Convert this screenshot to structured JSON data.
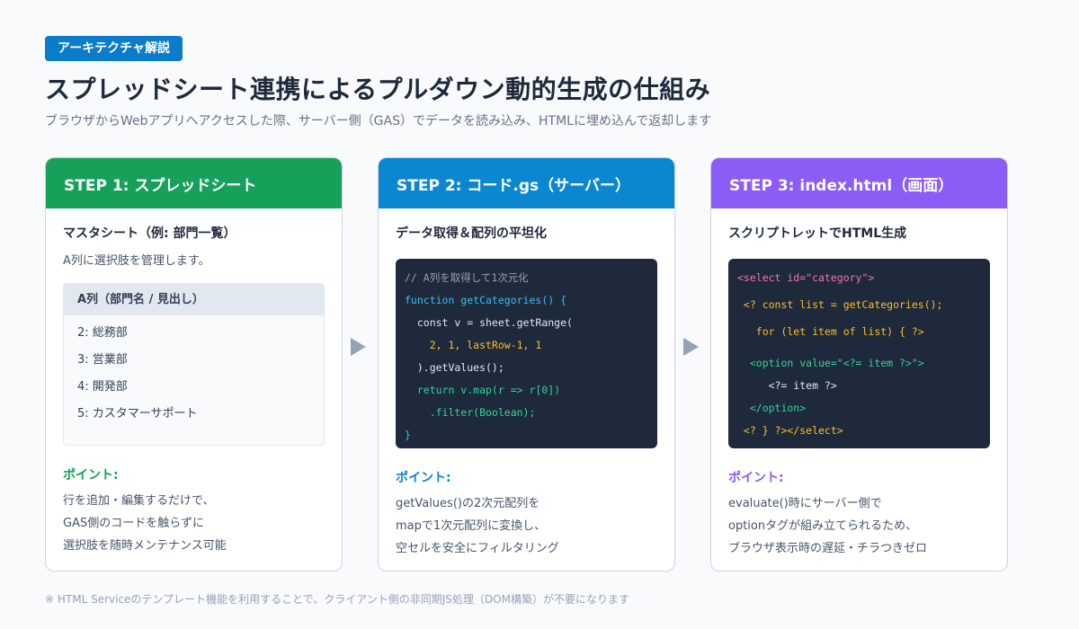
{
  "header": {
    "badge": "アーキテクチャ解説",
    "title": "スプレッドシート連携によるプルダウン動的生成の仕組み",
    "subtitle": "ブラウザからWebアプリへアクセスした際、サーバー側（GAS）でデータを読み込み、HTMLに埋め込んで返却します"
  },
  "colors": {
    "step1": "#16a05a",
    "step2": "#0b87d1",
    "step3": "#8b5cf6",
    "code_comment": "#94a3b8",
    "code_keyword": "#38bdf8",
    "code_text": "#e2e8f0",
    "code_number": "#fbbf24",
    "code_green": "#34d399",
    "code_tag": "#f472b6"
  },
  "step1": {
    "header": "STEP 1: スプレッドシート",
    "section_title": "マスタシート（例: 部門一覧）",
    "section_desc": "A列に選択肢を管理します。",
    "table_header": "A列（部門名 / 見出し）",
    "rows": [
      "2: 総務部",
      "3: 営業部",
      "4: 開発部",
      "5: カスタマーサポート"
    ],
    "point_title": "ポイント:",
    "point_lines": [
      "行を追加・編集するだけで、",
      "GAS側のコードを触らずに",
      "選択肢を随時メンテナンス可能"
    ]
  },
  "step2": {
    "header": "STEP 2: コード.gs（サーバー）",
    "section_title": "データ取得＆配列の平坦化",
    "code": [
      {
        "text": "// A列を取得して1次元化",
        "color": "#94a3b8"
      },
      {
        "text": "function getCategories() {",
        "color": "#38bdf8"
      },
      {
        "text": "  const v = sheet.getRange(",
        "color": "#e2e8f0"
      },
      {
        "text": "    2, 1, lastRow-1, 1",
        "color": "#fbbf24"
      },
      {
        "text": "  ).getValues();",
        "color": "#e2e8f0"
      },
      {
        "text": "  return v.map(r => r[0])",
        "color": "#34d399"
      },
      {
        "text": "    .filter(Boolean);",
        "color": "#34d399"
      },
      {
        "text": "}",
        "color": "#38bdf8"
      }
    ],
    "point_title": "ポイント:",
    "point_lines": [
      "getValues()の2次元配列を",
      "mapで1次元配列に変換し、",
      "空セルを安全にフィルタリング"
    ]
  },
  "step3": {
    "header": "STEP 3: index.html（画面）",
    "section_title": "スクリプトレットでHTML生成",
    "code": [
      {
        "text": "<select id=\"category\">",
        "color": "#f472b6"
      },
      {
        "text": " <? const list = getCategories();",
        "color": "#fbbf24"
      },
      {
        "text": "   for (let item of list) { ?>",
        "color": "#fbbf24"
      },
      {
        "text": "  <option value=\"<?= item ?>\">",
        "color": "#34d399"
      },
      {
        "text": "     <?= item ?>",
        "color": "#e2e8f0"
      },
      {
        "text": "  </option>",
        "color": "#34d399"
      },
      {
        "text": " <? } ?></select>",
        "color": "#fbbf24"
      }
    ],
    "point_title": "ポイント:",
    "point_lines": [
      "evaluate()時にサーバー側で",
      "optionタグが組み立てられるため、",
      "ブラウザ表示時の遅延・チラつきゼロ"
    ]
  },
  "footnote": "※ HTML Serviceのテンプレート機能を利用することで、クライアント側の非同期JS処理（DOM構築）が不要になります"
}
